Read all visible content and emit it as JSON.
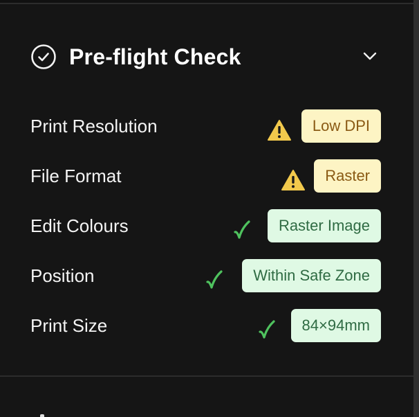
{
  "section": {
    "title": "Pre-flight Check",
    "icon": "check-circle-icon",
    "toggle_icon": "chevron-down-icon"
  },
  "colors": {
    "warn_bg": "#fdf4c4",
    "warn_text": "#8a5a14",
    "ok_bg": "#dff9e4",
    "ok_text": "#2f6b43",
    "check_green": "#4fc25e",
    "warning_yellow": "#f2c94c"
  },
  "checks": [
    {
      "label": "Print Resolution",
      "status": "warning",
      "icon": "warning-icon",
      "value": "Low DPI"
    },
    {
      "label": "File Format",
      "status": "warning",
      "icon": "warning-icon",
      "value": "Raster"
    },
    {
      "label": "Edit Colours",
      "status": "ok",
      "icon": "checkmark-icon",
      "value": "Raster Image"
    },
    {
      "label": "Position",
      "status": "ok",
      "icon": "checkmark-icon",
      "value": "Within Safe Zone"
    },
    {
      "label": "Print Size",
      "status": "ok",
      "icon": "checkmark-icon",
      "value": "84×94mm"
    }
  ]
}
